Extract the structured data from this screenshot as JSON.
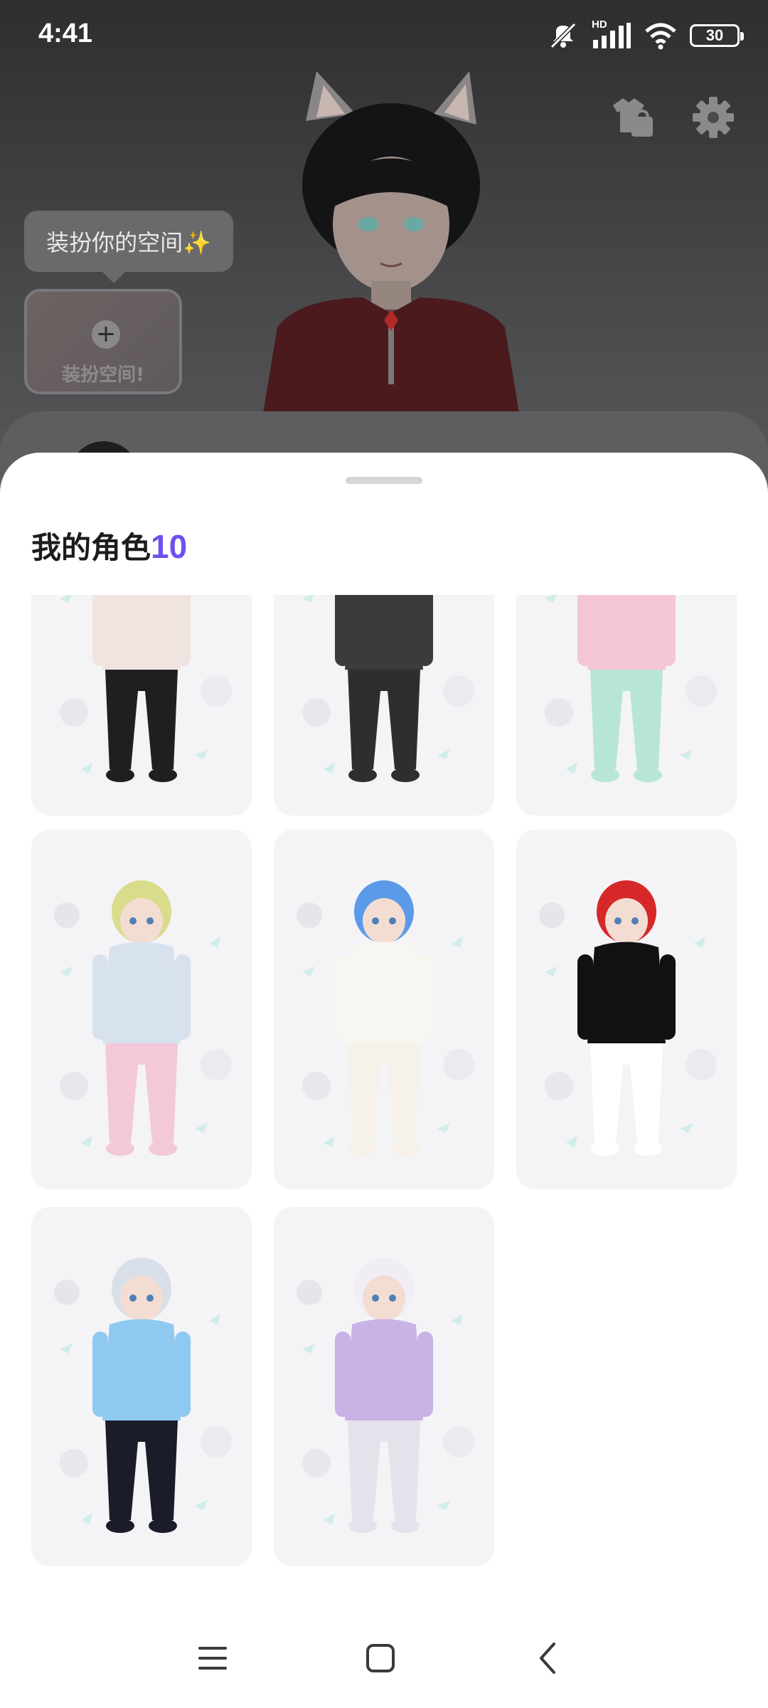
{
  "status_bar": {
    "time": "4:41",
    "network_label": "HD",
    "battery_level": "30",
    "icons": [
      "mute-icon",
      "signal-icon",
      "wifi-icon",
      "battery-icon"
    ]
  },
  "background": {
    "actions": [
      "wardrobe-shop-icon",
      "gear-icon"
    ],
    "tip_text": "装扮你的空间✨",
    "dress_space_label": "装扮空间!",
    "dress_space_icon": "plus-icon"
  },
  "sheet": {
    "title": "我的角色",
    "count": "10",
    "count_color": "#7050f0",
    "characters": [
      {
        "name": "black-pleated-skirt-outfit",
        "palette": [
          "#1f1f22",
          "#f0e4e0",
          "#e8e8ec"
        ]
      },
      {
        "name": "baggy-black-jeans-outfit",
        "palette": [
          "#2e2e30",
          "#3b3b3e",
          "#e8e8ec"
        ]
      },
      {
        "name": "mint-hair-pink-pants-outfit",
        "palette": [
          "#b8e6d6",
          "#f4c6d4",
          "#dff0ec"
        ]
      },
      {
        "name": "cat-beanie-pastel-outfit",
        "palette": [
          "#f3c8d8",
          "#d8e2ee",
          "#d9dc8a"
        ]
      },
      {
        "name": "sheep-hood-white-coat-outfit",
        "palette": [
          "#f6f2ea",
          "#f8f6f0",
          "#5b9ae8"
        ]
      },
      {
        "name": "cow-costume-red-hair-outfit",
        "palette": [
          "#ffffff",
          "#111111",
          "#d62828"
        ]
      },
      {
        "name": "blue-hair-mermaid-gown-outfit",
        "palette": [
          "#1a1c2a",
          "#8ec9f0",
          "#d8dfe8"
        ]
      },
      {
        "name": "lavender-angel-outfit",
        "palette": [
          "#e6e2ec",
          "#c9b2e6",
          "#f0eef4"
        ]
      }
    ]
  },
  "nav_bar": {
    "icons": [
      "menu-icon",
      "home-square-icon",
      "back-chevron-icon"
    ]
  }
}
